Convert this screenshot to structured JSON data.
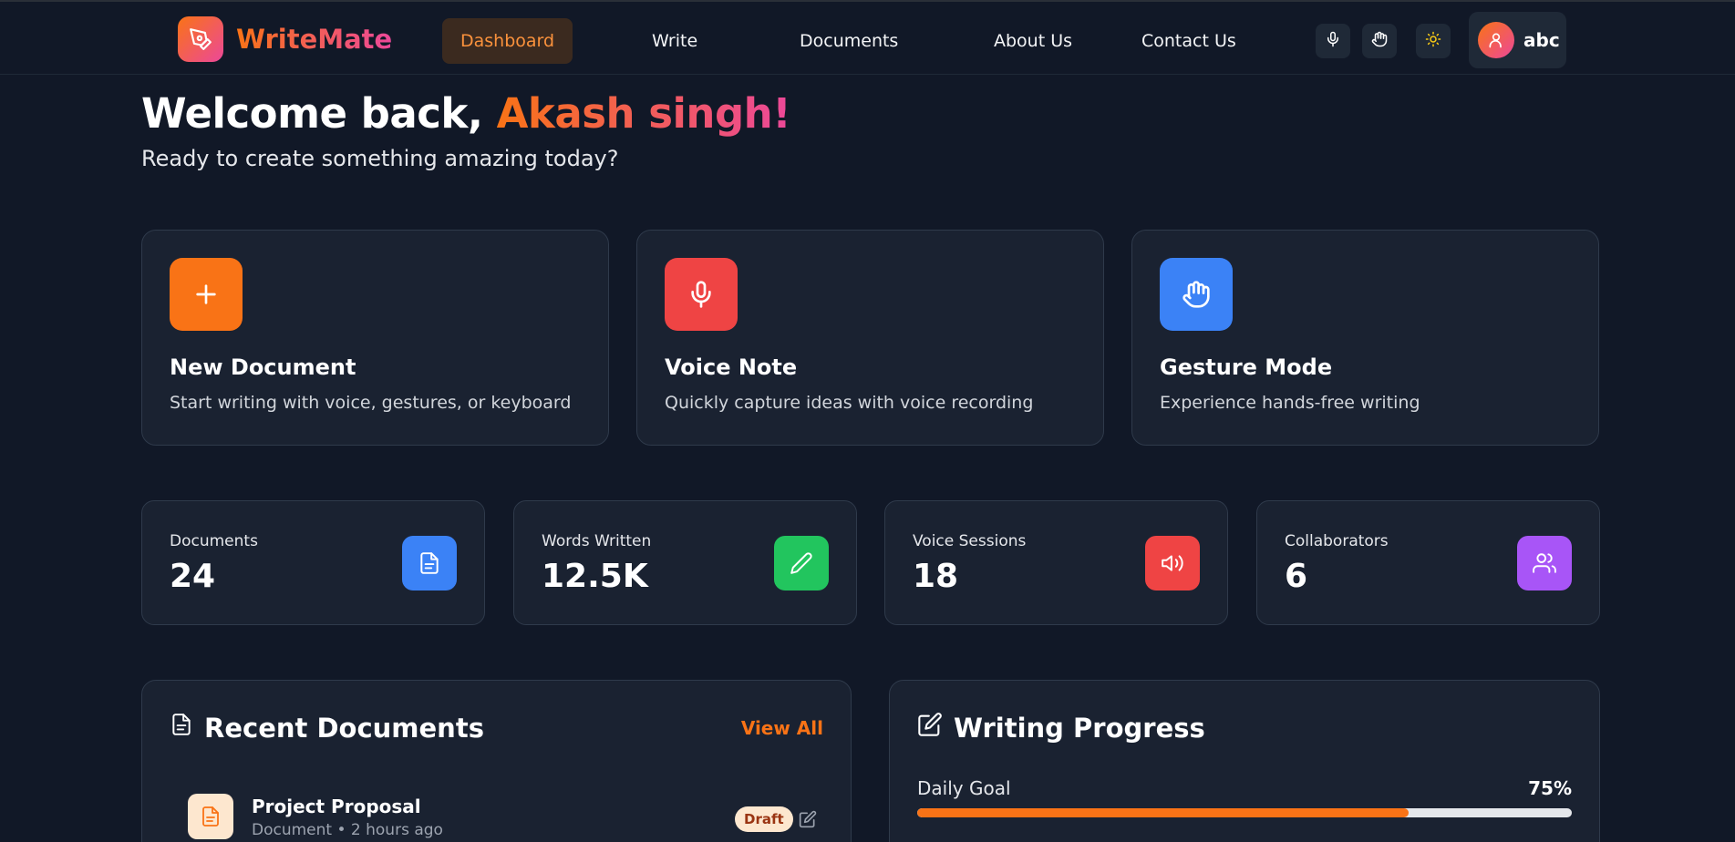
{
  "nav": {
    "brand": "WriteMate",
    "links": [
      {
        "label": "Dashboard",
        "active": true
      },
      {
        "label": "Write",
        "active": false
      },
      {
        "label": "Documents",
        "active": false
      },
      {
        "label": "About Us",
        "active": false
      },
      {
        "label": "Contact Us",
        "active": false
      }
    ],
    "icons": [
      "mic-icon",
      "hand-icon",
      "sun-icon"
    ],
    "user": {
      "name": "abc",
      "icon": "user-icon"
    }
  },
  "welcome": {
    "prefix": "Welcome back, ",
    "name": "Akash singh!",
    "subtitle": "Ready to create something amazing today?"
  },
  "actions": [
    {
      "title": "New Document",
      "desc": "Start writing with voice, gestures, or keyboard",
      "icon": "plus-icon",
      "color": "#f97316"
    },
    {
      "title": "Voice Note",
      "desc": "Quickly capture ideas with voice recording",
      "icon": "mic-icon",
      "color": "#ef4444"
    },
    {
      "title": "Gesture Mode",
      "desc": "Experience hands-free writing",
      "icon": "hand-icon",
      "color": "#3b82f6"
    }
  ],
  "stats": [
    {
      "label": "Documents",
      "value": "24",
      "icon": "file-icon",
      "color": "#3b82f6"
    },
    {
      "label": "Words Written",
      "value": "12.5K",
      "icon": "pencil-icon",
      "color": "#22c55e"
    },
    {
      "label": "Voice Sessions",
      "value": "18",
      "icon": "speaker-icon",
      "color": "#ef4444"
    },
    {
      "label": "Collaborators",
      "value": "6",
      "icon": "users-icon",
      "color": "#a855f7"
    }
  ],
  "recent": {
    "title": "Recent Documents",
    "view_all": "View All",
    "items": [
      {
        "title": "Project Proposal",
        "meta": "Document • 2 hours ago",
        "badge": "Draft"
      }
    ]
  },
  "progress": {
    "title": "Writing Progress",
    "daily_label": "Daily Goal",
    "daily_pct": "75%",
    "daily_value": 0.75
  },
  "colors": {
    "accent": "#f97316",
    "accent2": "#ec4899",
    "bg": "#111827",
    "card": "#1a2231"
  }
}
